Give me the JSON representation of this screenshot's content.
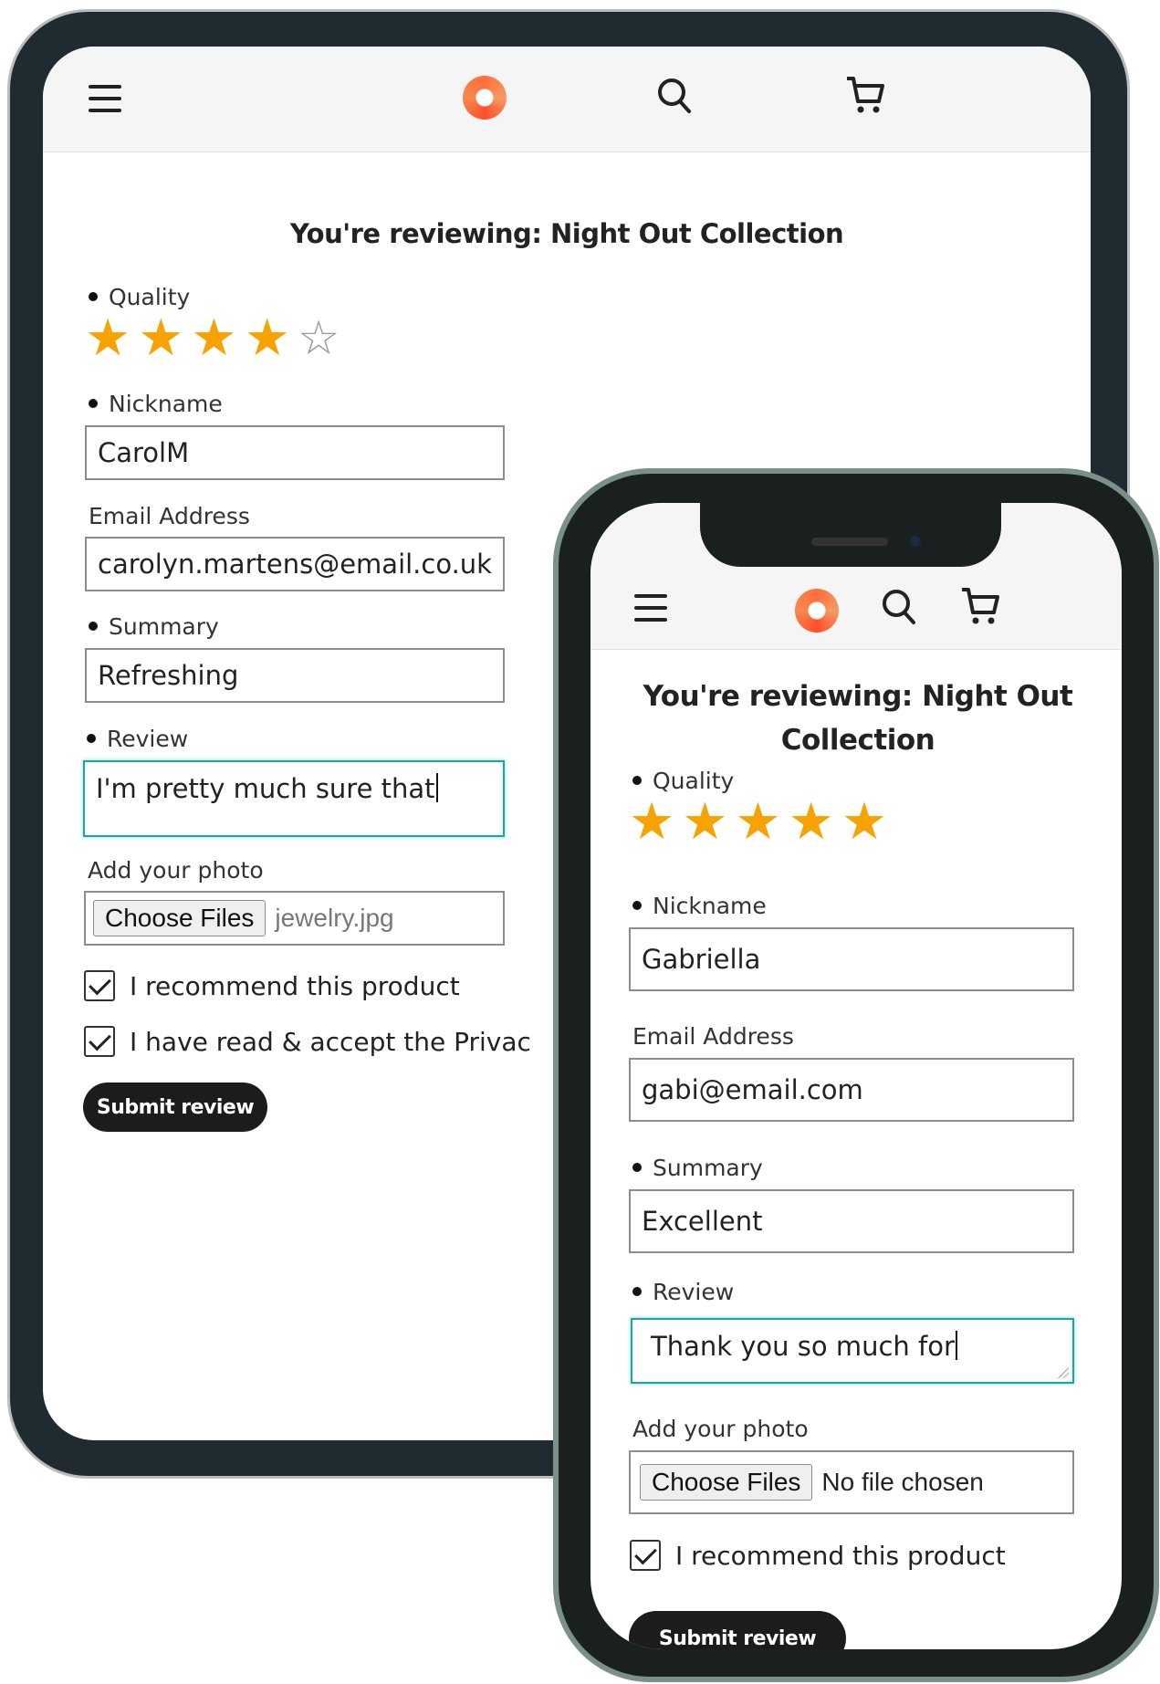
{
  "tablet": {
    "title": "You're reviewing: Night Out Collection",
    "quality_label": "Quality",
    "rating": 4,
    "nickname_label": "Nickname",
    "nickname_value": "CarolM",
    "email_label": "Email Address",
    "email_value": "carolyn.martens@email.co.uk",
    "summary_label": "Summary",
    "summary_value": "Refreshing",
    "review_label": "Review",
    "review_value": "I'm pretty much sure that",
    "photo_label": "Add your photo",
    "choose_files": "Choose Files",
    "file_name": "jewelry.jpg",
    "recommend": "I recommend this product",
    "privacy": "I have read & accept the Privac",
    "submit": "Submit review"
  },
  "phone": {
    "title": "You're reviewing: Night Out Collection",
    "quality_label": "Quality",
    "rating": 5,
    "nickname_label": "Nickname",
    "nickname_value": "Gabriella",
    "email_label": "Email Address",
    "email_value": "gabi@email.com",
    "summary_label": "Summary",
    "summary_value": "Excellent",
    "review_label": "Review",
    "review_value": "Thank you so much for",
    "photo_label": "Add your photo",
    "choose_files": "Choose Files",
    "file_name": "No file chosen",
    "recommend": "I recommend this product",
    "submit": "Submit review"
  },
  "icons": {
    "menu": "hamburger-icon",
    "logo": "brand-logo",
    "search": "search-icon",
    "cart": "cart-icon",
    "star": "star-icon"
  },
  "colors": {
    "star": "#f6a200",
    "focus_border": "#18a7a3",
    "button": "#1c1c1c",
    "logo": "#ff6f3c"
  }
}
